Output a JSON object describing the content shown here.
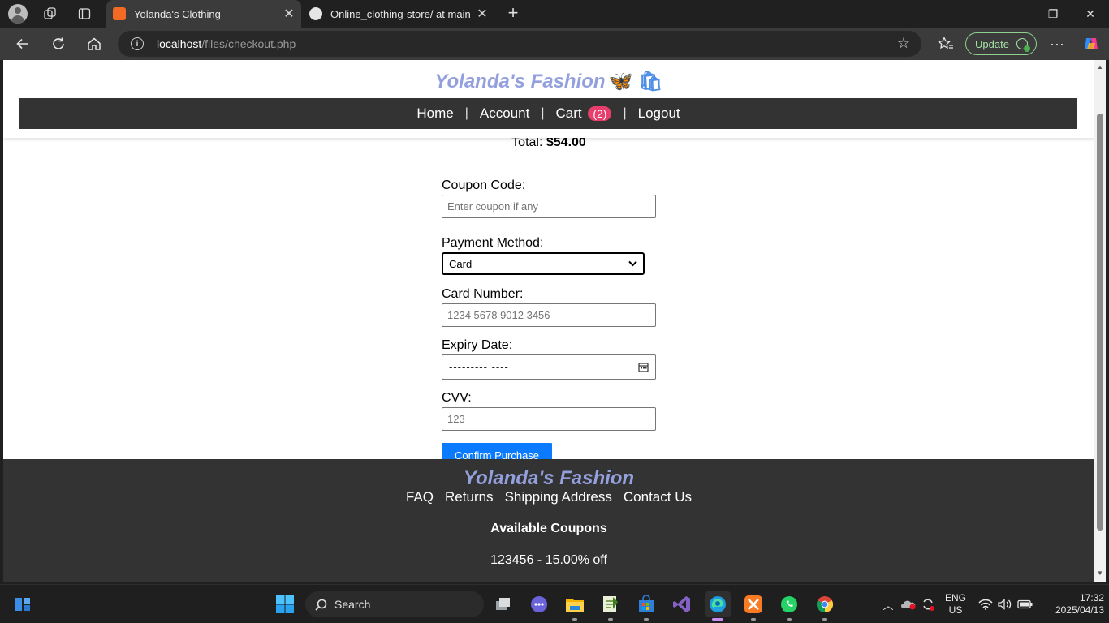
{
  "browser": {
    "tabs": [
      {
        "title": "Yolanda's Clothing",
        "active": true,
        "favicon_color": "#f26a23"
      },
      {
        "title": "Online_clothing-store/ at main · Y",
        "active": false,
        "favicon_color": "#e6e6e6"
      }
    ],
    "url_host": "localhost",
    "url_path": "/files/checkout.php",
    "update_label": "Update"
  },
  "site": {
    "brand": "Yolanda's Fashion",
    "brand_emoji": "🦋 🛍",
    "nav": {
      "home": "Home",
      "account": "Account",
      "cart": "Cart",
      "cart_count": "(2)",
      "logout": "Logout"
    }
  },
  "checkout": {
    "total_label": "Total:",
    "total_value": "$54.00",
    "coupon_label": "Coupon Code:",
    "coupon_placeholder": "Enter coupon if any",
    "payment_label": "Payment Method:",
    "payment_selected": "Card",
    "card_label": "Card Number:",
    "card_placeholder": "1234 5678 9012 3456",
    "expiry_label": "Expiry Date:",
    "expiry_value": "---------  ----",
    "cvv_label": "CVV:",
    "cvv_placeholder": "123",
    "confirm_label": "Confirm Purchase"
  },
  "footer": {
    "brand": "Yolanda's Fashion",
    "links": [
      "FAQ",
      "Returns",
      "Shipping Address",
      "Contact Us"
    ],
    "coupons_title": "Available Coupons",
    "coupon_line": "123456 - 15.00% off"
  },
  "taskbar": {
    "search_label": "Search",
    "lang": "ENG",
    "region": "US",
    "time": "17:32",
    "date": "2025/04/13"
  },
  "colors": {
    "brand": "#93a0dd",
    "nav_bg": "#333333",
    "badge": "#e83e6c",
    "confirm_button": "#0a7bff"
  }
}
